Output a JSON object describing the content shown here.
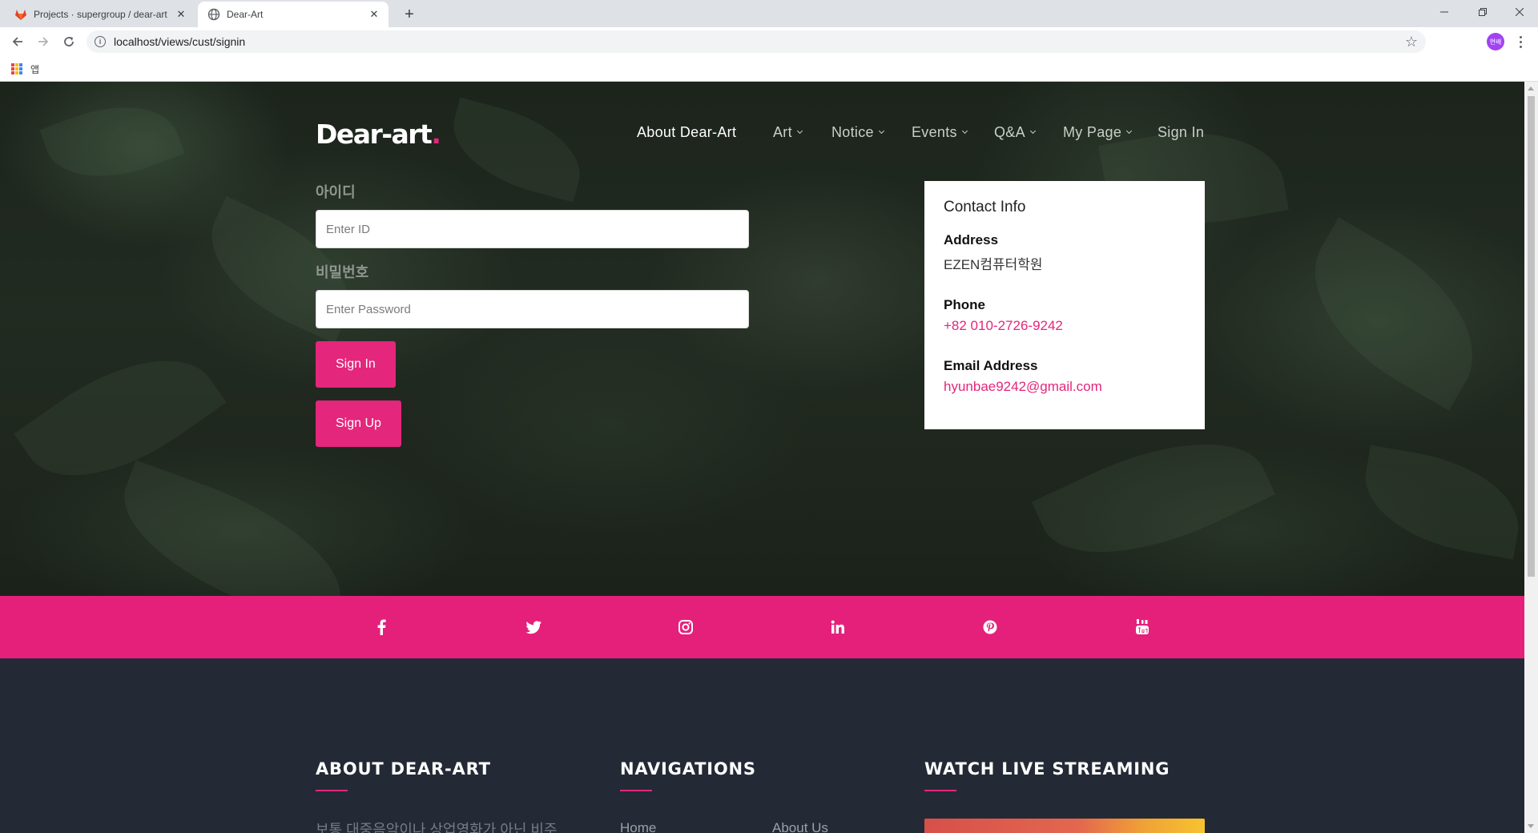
{
  "browser": {
    "tabs": [
      {
        "title": "Projects · supergroup / dear-art",
        "favicon": "gitlab-icon",
        "active": false
      },
      {
        "title": "Dear-Art",
        "favicon": "globe-icon",
        "active": true
      }
    ],
    "url": "localhost/views/cust/signin",
    "profile_initials": "현배",
    "bookmarks_apps_label": "앱"
  },
  "site": {
    "brand": "Dear-art",
    "brand_dot": ".",
    "nav": [
      {
        "label": "About Dear-Art",
        "dropdown": false,
        "active": true
      },
      {
        "label": "Art",
        "dropdown": true
      },
      {
        "label": "Notice",
        "dropdown": true
      },
      {
        "label": "Events",
        "dropdown": true
      },
      {
        "label": "Q&A",
        "dropdown": true
      },
      {
        "label": "My Page",
        "dropdown": true
      },
      {
        "label": "Sign In",
        "dropdown": false
      }
    ]
  },
  "signin": {
    "id_label": "아이디",
    "id_placeholder": "Enter ID",
    "pw_label": "비밀번호",
    "pw_placeholder": "Enter Password",
    "signin_button": "Sign In",
    "signup_button": "Sign Up"
  },
  "contact": {
    "title": "Contact Info",
    "address_label": "Address",
    "address_value": "EZEN컴퓨터학원",
    "phone_label": "Phone",
    "phone_value": "+82 010-2726-9242",
    "email_label": "Email Address",
    "email_value": "hyunbae9242@gmail.com"
  },
  "social": [
    "facebook-icon",
    "twitter-icon",
    "instagram-icon",
    "linkedin-icon",
    "pinterest-icon",
    "youtube-icon"
  ],
  "footer": {
    "about_heading": "ABOUT DEAR-ART",
    "about_text": "보통 대중음악이나 상업영화가 아닌 비주",
    "nav_heading": "NAVIGATIONS",
    "nav_links": [
      "Home",
      "About Us"
    ],
    "stream_heading": "WATCH LIVE STREAMING"
  },
  "colors": {
    "accent": "#e4267c",
    "social_bar": "#e4207b",
    "footer_bg": "#232a35"
  }
}
